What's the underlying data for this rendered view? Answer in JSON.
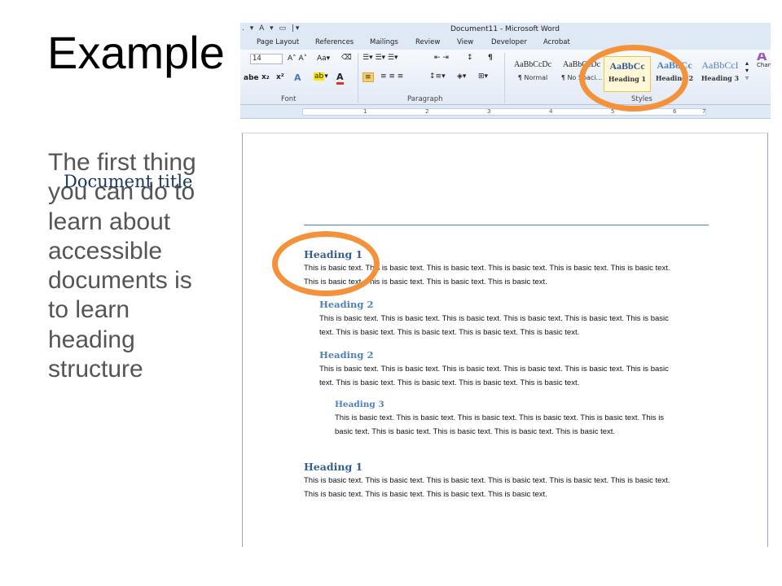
{
  "slide": {
    "title": "Example",
    "body": "The first thing you can do to learn about accessible documents is to learn heading structure"
  },
  "word": {
    "window_title": "Document11 - Microsoft Word",
    "qat": ". ▾ A ▾ ▭ |▾",
    "tabs": [
      "Page Layout",
      "References",
      "Mailings",
      "Review",
      "View",
      "Developer",
      "Acrobat"
    ],
    "font_size": "14",
    "groups": {
      "font": "Font",
      "paragraph": "Paragraph",
      "styles": "Styles"
    },
    "styles": [
      {
        "sample": "AaBbCcDc",
        "name": "¶ Normal"
      },
      {
        "sample": "AaBbCcDc",
        "name": "¶ No Spaci..."
      },
      {
        "sample": "AaBbCc",
        "name": "Heading 1"
      },
      {
        "sample": "AaBbCc",
        "name": "Heading 2"
      },
      {
        "sample": "AaBbCcI",
        "name": "Heading 3"
      }
    ],
    "change_styles": "Change Styles",
    "ruler_numbers": [
      "1",
      "2",
      "3",
      "4",
      "5",
      "6",
      "7"
    ],
    "colors": {
      "accent_orange": "#f4923c",
      "heading_blue": "#365f91",
      "title_blue": "#17365d"
    }
  },
  "document": {
    "title": "Document title",
    "sections": [
      {
        "heading": "Heading 1",
        "level": 1,
        "line1": "This is basic text. This is basic text. This is basic text. This is basic text. This is basic text. This is basic text.",
        "line2": "This is basic text. This is basic text. This is basic text. This is basic text."
      },
      {
        "heading": "Heading 2",
        "level": 2,
        "line1": "This is basic text. This is basic text. This is basic text. This is basic text. This is basic text. This is basic",
        "line2": "text. This is basic text. This is basic text. This is basic text. This is basic text."
      },
      {
        "heading": "Heading 2",
        "level": 2,
        "line1": "This is basic text. This is basic text. This is basic text. This is basic text. This is basic text. This is basic",
        "line2": "text. This is basic text. This is basic text. This is basic text. This is basic text."
      },
      {
        "heading": "Heading 3",
        "level": 3,
        "line1": "This is basic text. This is basic text. This is basic text. This is basic text. This is basic text. This is",
        "line2": "basic text. This is basic text. This is basic text. This is basic text. This is basic text."
      },
      {
        "heading": "Heading 1",
        "level": 1,
        "line1": "This is basic text. This is basic text. This is basic text. This is basic text. This is basic text. This is basic text.",
        "line2": "This is basic text. This is basic text. This is basic text. This is basic text."
      }
    ]
  }
}
